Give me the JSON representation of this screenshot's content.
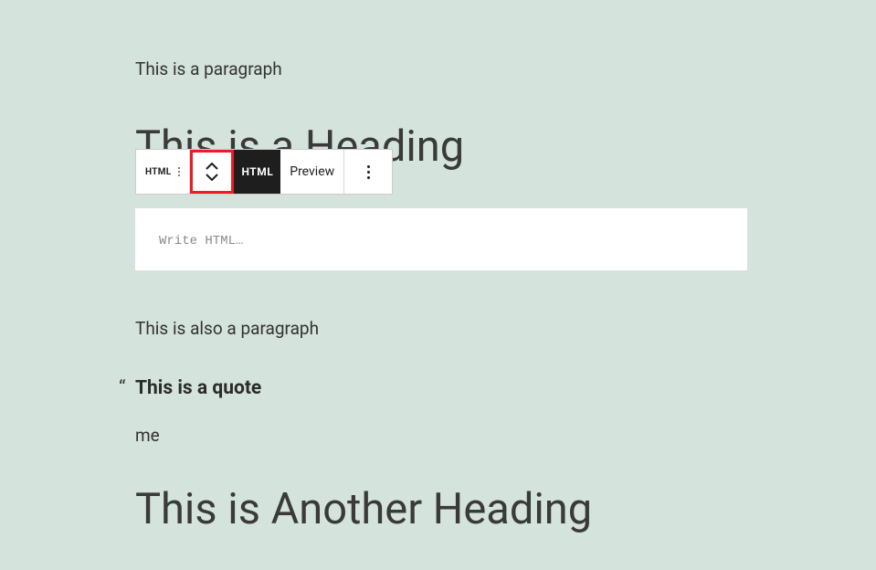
{
  "content": {
    "paragraph1": "This is a paragraph",
    "heading1": "This is a Heading",
    "paragraph2": "This is also a paragraph",
    "quote_mark": "“",
    "quote_text": "This is a quote",
    "citation": "me",
    "heading2": "This is Another Heading"
  },
  "toolbar": {
    "html_mini": "HTML",
    "html_badge": "HTML",
    "preview_label": "Preview"
  },
  "html_block": {
    "placeholder": "Write HTML…"
  }
}
